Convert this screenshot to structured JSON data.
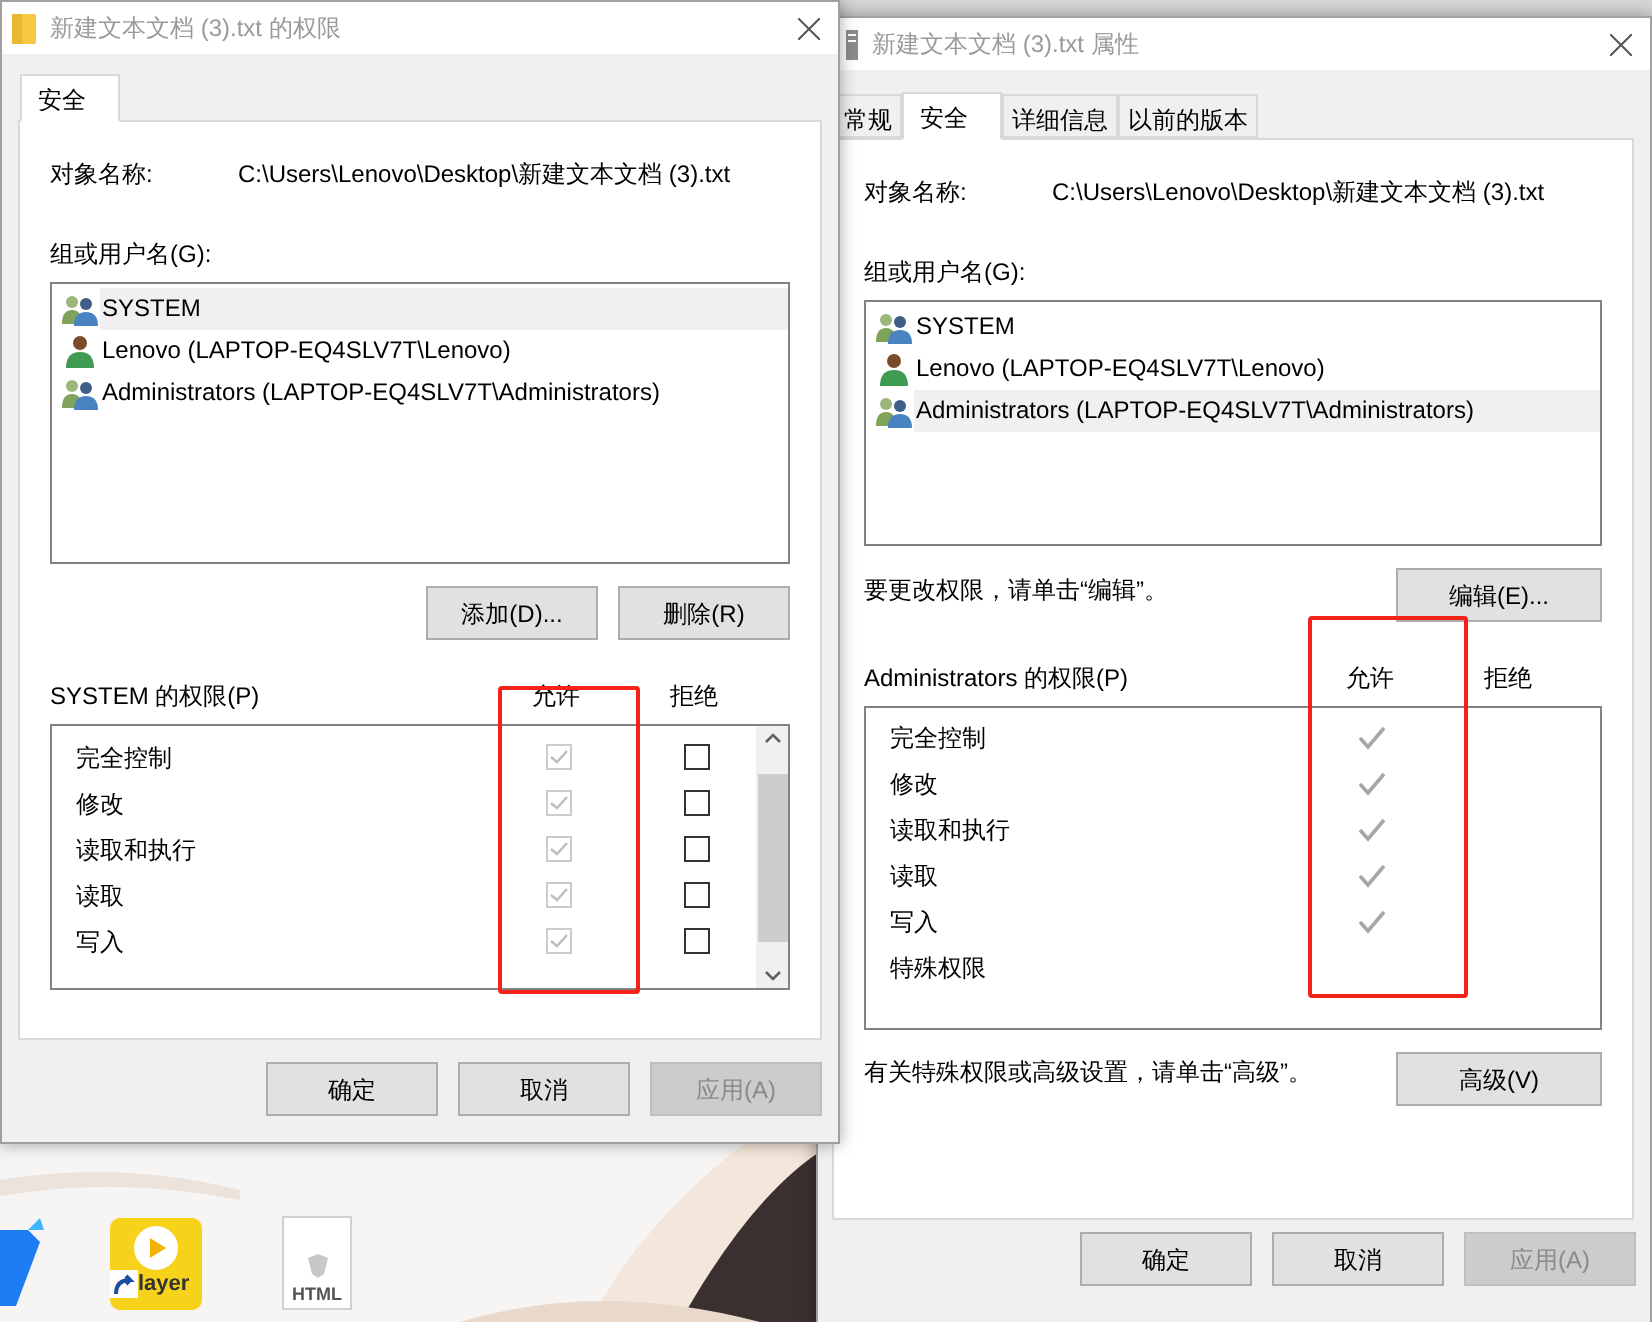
{
  "desktop": {
    "icons": [
      {
        "kind": "app"
      },
      {
        "kind": "player",
        "label": "layer"
      },
      {
        "kind": "html",
        "label": "HTML"
      }
    ]
  },
  "windows": [
    {
      "title": "新建文本文档 (3).txt 的权限",
      "tabs": [
        {
          "label": "安全",
          "selected": true
        }
      ],
      "object_label": "对象名称:",
      "object_path": "C:\\Users\\Lenovo\\Desktop\\新建文本文档 (3).txt",
      "groups_label": "组或用户名(G):",
      "groups": [
        {
          "name": "SYSTEM",
          "kind": "group",
          "selected": true
        },
        {
          "name": "Lenovo (LAPTOP-EQ4SLV7T\\Lenovo)",
          "kind": "user",
          "selected": false
        },
        {
          "name": "Administrators (LAPTOP-EQ4SLV7T\\Administrators)",
          "kind": "group",
          "selected": false
        }
      ],
      "group_buttons": [
        {
          "label": "添加(D)..."
        },
        {
          "label": "删除(R)"
        }
      ],
      "permissions": {
        "label": "SYSTEM 的权限(P)",
        "allow_label": "允许",
        "deny_label": "拒绝",
        "kind": "checkbox",
        "allow_locked": true,
        "rows": [
          {
            "name": "完全控制",
            "allow": true,
            "deny": false
          },
          {
            "name": "修改",
            "allow": true,
            "deny": false
          },
          {
            "name": "读取和执行",
            "allow": true,
            "deny": false
          },
          {
            "name": "读取",
            "allow": true,
            "deny": false
          },
          {
            "name": "写入",
            "allow": true,
            "deny": false
          }
        ]
      },
      "footer": [
        {
          "label": "确定",
          "disabled": false
        },
        {
          "label": "取消",
          "disabled": false
        },
        {
          "label": "应用(A)",
          "disabled": true
        }
      ]
    },
    {
      "title": "新建文本文档 (3).txt 属性",
      "tabs": [
        {
          "label": "常规",
          "selected": false
        },
        {
          "label": "安全",
          "selected": true
        },
        {
          "label": "详细信息",
          "selected": false
        },
        {
          "label": "以前的版本",
          "selected": false
        }
      ],
      "object_label": "对象名称:",
      "object_path": "C:\\Users\\Lenovo\\Desktop\\新建文本文档 (3).txt",
      "groups_label": "组或用户名(G):",
      "groups": [
        {
          "name": "SYSTEM",
          "kind": "group",
          "selected": false
        },
        {
          "name": "Lenovo (LAPTOP-EQ4SLV7T\\Lenovo)",
          "kind": "user",
          "selected": false
        },
        {
          "name": "Administrators (LAPTOP-EQ4SLV7T\\Administrators)",
          "kind": "group",
          "selected": true
        }
      ],
      "edit_hint": "要更改权限，请单击“编辑”。",
      "edit_button": "编辑(E)...",
      "permissions": {
        "label": "Administrators 的权限(P)",
        "allow_label": "允许",
        "deny_label": "拒绝",
        "kind": "readonly",
        "rows": [
          {
            "name": "完全控制",
            "allow": true,
            "deny": false
          },
          {
            "name": "修改",
            "allow": true,
            "deny": false
          },
          {
            "name": "读取和执行",
            "allow": true,
            "deny": false
          },
          {
            "name": "读取",
            "allow": true,
            "deny": false
          },
          {
            "name": "写入",
            "allow": true,
            "deny": false
          },
          {
            "name": "特殊权限",
            "allow": false,
            "deny": false
          }
        ]
      },
      "advanced_hint": "有关特殊权限或高级设置，请单击“高级”。",
      "advanced_button": "高级(V)",
      "footer": [
        {
          "label": "确定",
          "disabled": false
        },
        {
          "label": "取消",
          "disabled": false
        },
        {
          "label": "应用(A)",
          "disabled": true
        }
      ]
    }
  ]
}
